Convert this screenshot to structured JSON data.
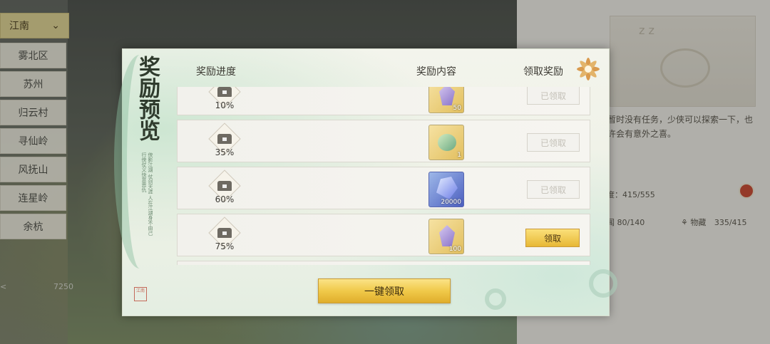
{
  "sidebar": {
    "region_selected": "江南",
    "regions": [
      "雾北区",
      "苏州",
      "归云村",
      "寻仙岭",
      "风抚山",
      "连星岭",
      "余杭"
    ],
    "footer_left": "<",
    "footer_value": "7250"
  },
  "right_panel": {
    "notice": "暂时没有任务，少侠可以探索一下，也许会有意外之喜。",
    "stat_progress": "度：415/555",
    "stat_news": "闻 80/140",
    "stat_collect_label": "物藏",
    "stat_collect_value": "335/415"
  },
  "dialog": {
    "title": "奖励预览",
    "subtitle": "侠影江湖 仗剑天涯 人在江湖身不由己 行侠仗义快意恩仇",
    "seal": "江南",
    "col_progress": "奖励进度",
    "col_content": "奖励内容",
    "col_claim": "领取奖励",
    "claim_all_label": "一键领取",
    "rows": [
      {
        "progress": "10%",
        "qty": "50",
        "status": "已领取"
      },
      {
        "progress": "35%",
        "qty": "1",
        "status": "已领取"
      },
      {
        "progress": "60%",
        "qty": "20000",
        "status": "已领取"
      },
      {
        "progress": "75%",
        "qty": "100",
        "status": "领取"
      }
    ]
  },
  "colors": {
    "accent_gold": "#f0c94a",
    "dialog_bg": "#eef1e6",
    "claimed_text": "#c4c1b8"
  }
}
